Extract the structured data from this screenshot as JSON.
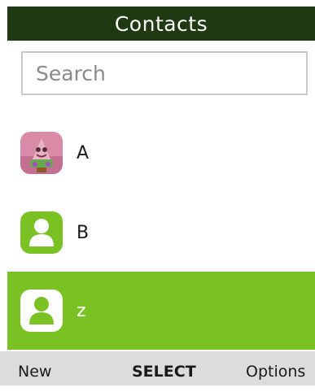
{
  "header": {
    "title": "Contacts"
  },
  "search": {
    "placeholder": "Search",
    "value": ""
  },
  "contacts": [
    {
      "name": "A",
      "avatar": "photo-avatar-icon",
      "selected": false
    },
    {
      "name": "B",
      "avatar": "person-icon",
      "selected": false
    },
    {
      "name": "z",
      "avatar": "person-icon",
      "selected": true
    }
  ],
  "softkeys": {
    "left": "New",
    "center": "SELECT",
    "right": "Options"
  },
  "colors": {
    "title_bar_bg": "#1f3a12",
    "accent_green": "#7ac224",
    "softkey_bar_bg": "#dcdcdc"
  }
}
